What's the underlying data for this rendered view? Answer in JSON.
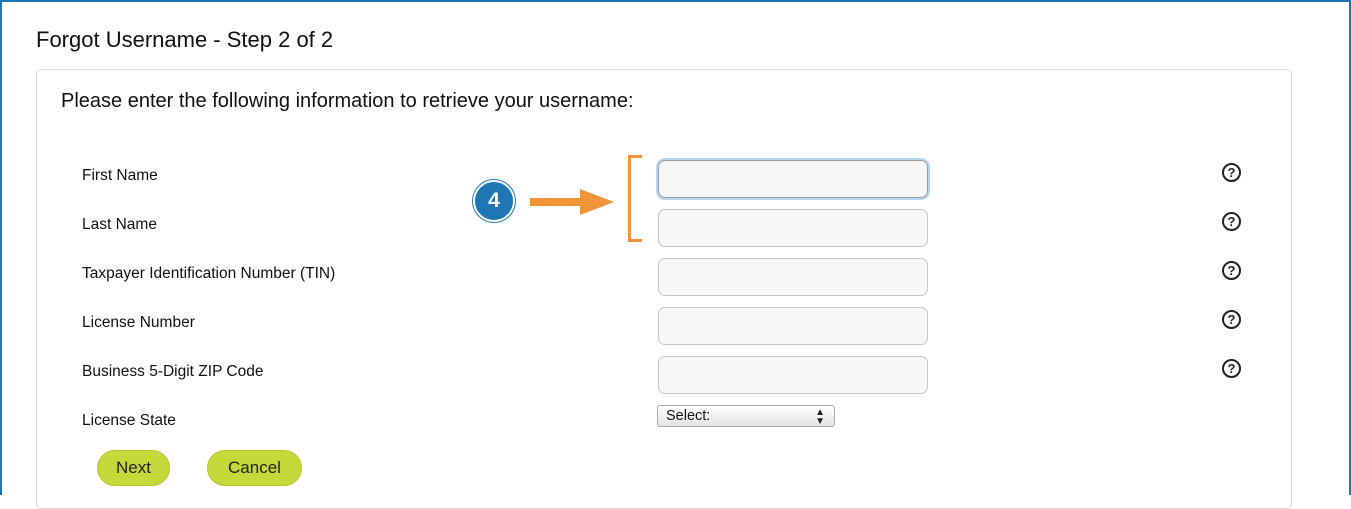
{
  "page": {
    "title": "Forgot Username - Step 2 of 2",
    "instructions": "Please enter the following information to retrieve your username:"
  },
  "form": {
    "fields": [
      {
        "label": "First Name",
        "value": ""
      },
      {
        "label": "Last Name",
        "value": ""
      },
      {
        "label": "Taxpayer Identification Number (TIN)",
        "value": ""
      },
      {
        "label": "License Number",
        "value": ""
      },
      {
        "label": "Business 5-Digit ZIP Code",
        "value": ""
      }
    ],
    "license_state": {
      "label": "License State",
      "selected": "Select:"
    },
    "help_symbol": "?",
    "next_label": "Next",
    "cancel_label": "Cancel"
  },
  "annotation": {
    "step_number": "4",
    "badge_color": "#1f76b4",
    "arrow_color": "#f0943a"
  },
  "colors": {
    "frame_border": "#1f76b4",
    "button_fill": "#c6d93a"
  }
}
